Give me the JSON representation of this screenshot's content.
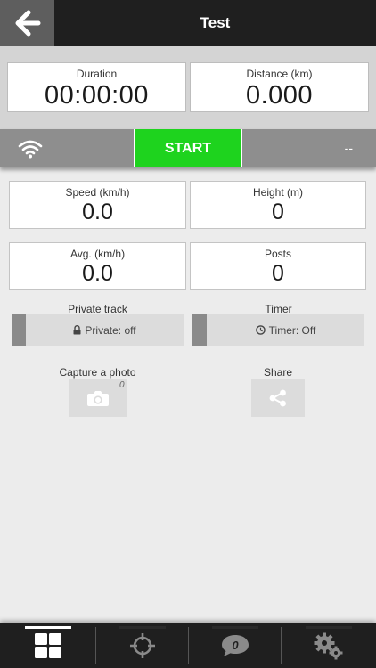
{
  "header": {
    "title": "Test",
    "back_icon": "arrow-left-icon"
  },
  "summary": {
    "duration": {
      "label": "Duration",
      "value": "00:00:00"
    },
    "distance": {
      "label": "Distance (km)",
      "value": "0.000"
    }
  },
  "controls": {
    "wifi_icon": "wifi-icon",
    "start_label": "START",
    "gps_status": "--"
  },
  "stats": {
    "speed": {
      "label": "Speed (km/h)",
      "value": "0.0"
    },
    "height": {
      "label": "Height (m)",
      "value": "0"
    },
    "avg": {
      "label": "Avg. (km/h)",
      "value": "0.0"
    },
    "posts": {
      "label": "Posts",
      "value": "0"
    }
  },
  "toggles": {
    "private": {
      "label": "Private track",
      "text": "Private: off",
      "icon": "lock-icon",
      "state": "off"
    },
    "timer": {
      "label": "Timer",
      "text": "Timer: Off",
      "icon": "clock-icon",
      "state": "off"
    }
  },
  "actions": {
    "photo": {
      "label": "Capture a photo",
      "icon": "camera-icon",
      "count": "0"
    },
    "share": {
      "label": "Share",
      "icon": "share-icon"
    }
  },
  "tabs": [
    {
      "icon": "dashboard-grid-icon",
      "active": true
    },
    {
      "icon": "crosshair-icon",
      "active": false
    },
    {
      "icon": "chat-bubble-icon",
      "badge": "0",
      "active": false
    },
    {
      "icon": "settings-gears-icon",
      "active": false
    }
  ],
  "colors": {
    "start": "#1ed31e",
    "topbar": "#1f1f1f",
    "background": "#ececec"
  }
}
